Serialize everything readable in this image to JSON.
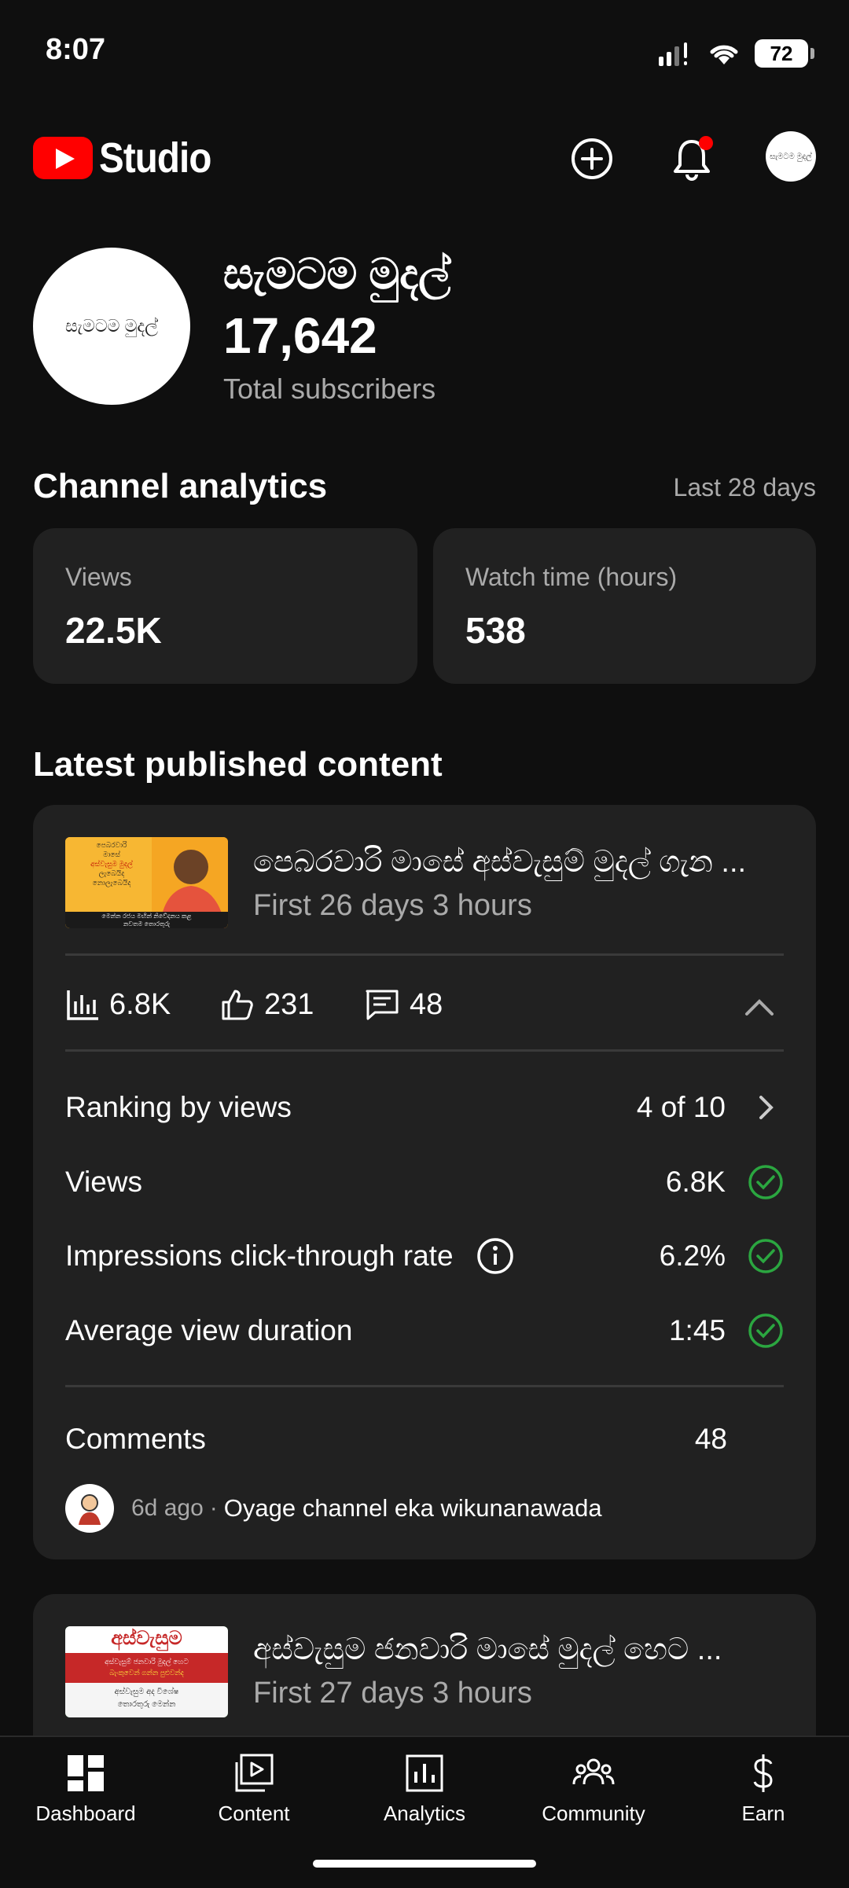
{
  "status_bar": {
    "time": "8:07",
    "battery": "72"
  },
  "header": {
    "app_name": "Studio",
    "avatar_text": "සැමටම මුදල්"
  },
  "channel": {
    "avatar_text": "සැමටම මුදල්",
    "name": "සැමටම මුදල්",
    "subscribers": "17,642",
    "subscribers_label": "Total subscribers"
  },
  "analytics": {
    "title": "Channel analytics",
    "period": "Last 28 days",
    "metrics": [
      {
        "label": "Views",
        "value": "22.5K"
      },
      {
        "label": "Watch time (hours)",
        "value": "538"
      }
    ]
  },
  "latest": {
    "title": "Latest published content",
    "videos": [
      {
        "title": "පෙබරවාරි මාසේ අස්වැසුම් මුදල් ගැන ...",
        "subtitle": "First 26 days 3 hours",
        "thumb_text": [
          "පෙබරවාරි",
          "මාසේ",
          "අස්වැසුම මුදල්",
          "ලැබෙයිද",
          "නොලැබෙයිද",
          "මෙන්න රජය මඟින් නිවේදනය කළ",
          "නවතම තොරතුරු"
        ],
        "views": "6.8K",
        "likes": "231",
        "comments": "48",
        "details": [
          {
            "label": "Ranking by views",
            "value": "4 of 10"
          },
          {
            "label": "Views",
            "value": "6.8K"
          },
          {
            "label": "Impressions click-through rate",
            "value": "6.2%"
          },
          {
            "label": "Average view duration",
            "value": "1:45"
          }
        ],
        "comments_label": "Comments",
        "comments_count": "48",
        "latest_comment": {
          "age": "6d ago",
          "separator": "·",
          "text": "Oyage channel eka wikunanawada"
        }
      },
      {
        "title": "අස්වැසුම ජනවාරි මාසේ මුදල් හෙට ...",
        "subtitle": "First 27 days 3 hours",
        "thumb_text": [
          "අස්වැසුම",
          "අස්වැසුම් ජනවාරි මුදල් හෙට",
          "බැංකුවෙන් ගන්න පුළුවන්ද",
          "අස්වැසුම අද විශේෂ",
          "තොරතුරු මෙන්න"
        ]
      }
    ]
  },
  "nav": [
    {
      "label": "Dashboard",
      "icon": "dashboard-icon"
    },
    {
      "label": "Content",
      "icon": "content-icon"
    },
    {
      "label": "Analytics",
      "icon": "analytics-icon"
    },
    {
      "label": "Community",
      "icon": "community-icon"
    },
    {
      "label": "Earn",
      "icon": "dollar-icon"
    }
  ],
  "colors": {
    "accent_red": "#ff0000",
    "check_green": "#2ba640",
    "background": "#0f0f0f",
    "card": "#212121"
  }
}
